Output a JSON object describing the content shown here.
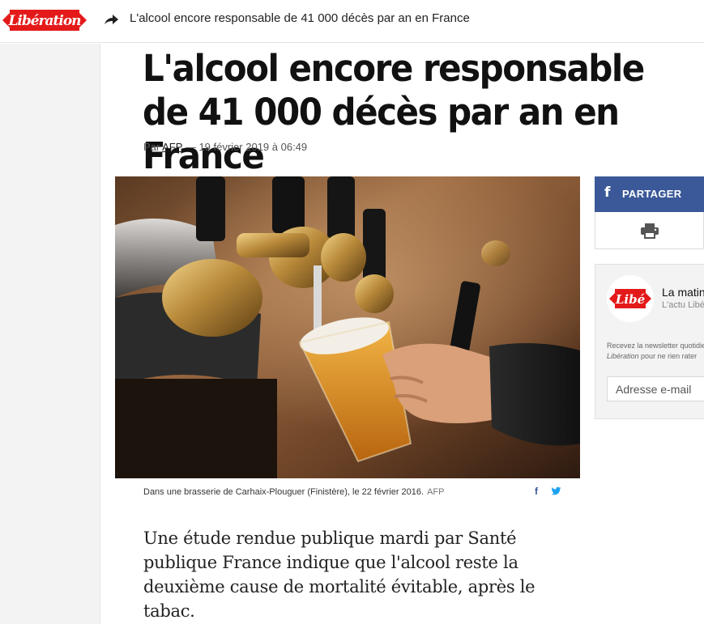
{
  "site": {
    "logo_text": "Libération",
    "brand_color": "#e41a1a"
  },
  "topbar": {
    "share_icon": "share-arrow-icon",
    "title": "L'alcool encore responsable de 41 000 décès par an en France"
  },
  "article": {
    "headline": "L'alcool encore responsable de 41 000 décès par an en France",
    "byline_prefix": "Par",
    "author": "AFP",
    "byline_date": "— 19 février 2019 à 06:49",
    "caption": "Dans une brasserie de Carhaix-Plouguer (Finistère), le 22 février 2016.",
    "caption_credit": "AFP",
    "caption_share_icons": [
      "facebook-icon",
      "twitter-icon"
    ],
    "chapo": "Une étude rendue publique mardi par Santé publique France indique que l'alcool reste la deuxième cause de mortalité évitable, après le tabac."
  },
  "share": {
    "facebook_label": "PARTAGER",
    "facebook_glyph": "f",
    "facebook_color": "#3b5998",
    "print_icon": "printer-icon"
  },
  "newsletter": {
    "logo_text": "Libé",
    "title": "La matinale",
    "subtitle": "L'actu Libé",
    "description_line1": "Recevez la newsletter quotidienne",
    "description_brand": "Libération",
    "description_line2": "pour ne rien rater",
    "email_placeholder": "Adresse e-mail"
  }
}
